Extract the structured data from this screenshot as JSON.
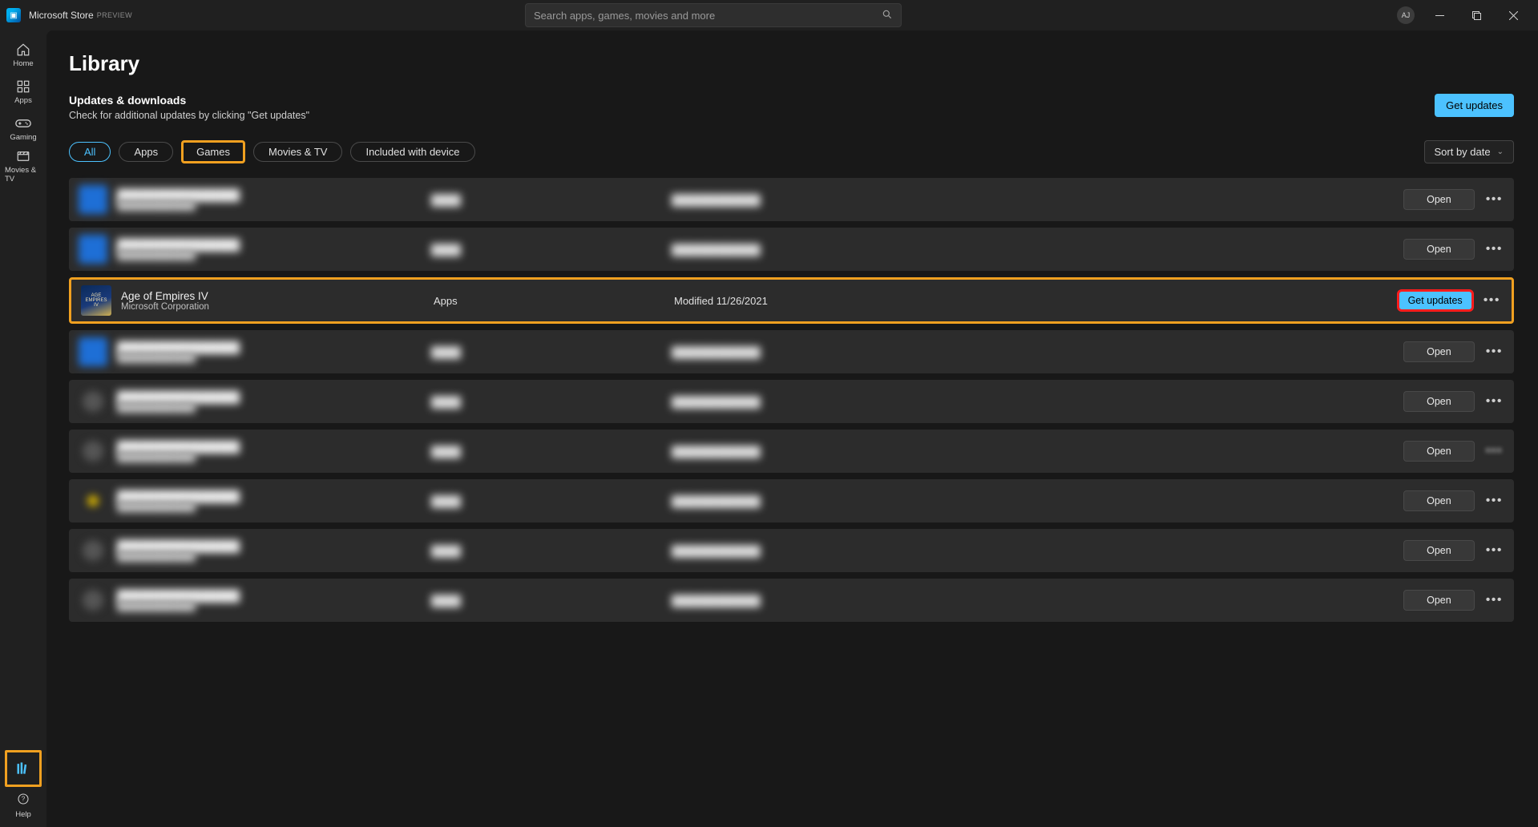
{
  "app": {
    "title": "Microsoft Store",
    "preview_badge": "PREVIEW",
    "search_placeholder": "Search apps, games, movies and more",
    "user_initials": "AJ"
  },
  "sidebar": {
    "items": [
      {
        "label": "Home",
        "glyph": "⌂"
      },
      {
        "label": "Apps",
        "glyph": "▦"
      },
      {
        "label": "Gaming",
        "glyph": "🎮"
      },
      {
        "label": "Movies & TV",
        "glyph": "▭"
      }
    ],
    "library_label": "Library",
    "help_label": "Help"
  },
  "page": {
    "title": "Library",
    "section_title": "Updates & downloads",
    "section_subtitle": "Check for additional updates by clicking \"Get updates\"",
    "get_updates_button": "Get updates",
    "sort_label": "Sort by date"
  },
  "filters": {
    "all": "All",
    "apps": "Apps",
    "games": "Games",
    "movies": "Movies & TV",
    "included": "Included with device"
  },
  "rows": {
    "open_label": "Open",
    "get_updates_label": "Get updates",
    "featured": {
      "title": "Age of Empires IV",
      "publisher": "Microsoft Corporation",
      "type": "Apps",
      "modified": "Modified 11/26/2021"
    },
    "blurred_generic": {
      "title": "████████████████",
      "publisher": "████████████",
      "type": "████",
      "modified": "████████████"
    }
  }
}
